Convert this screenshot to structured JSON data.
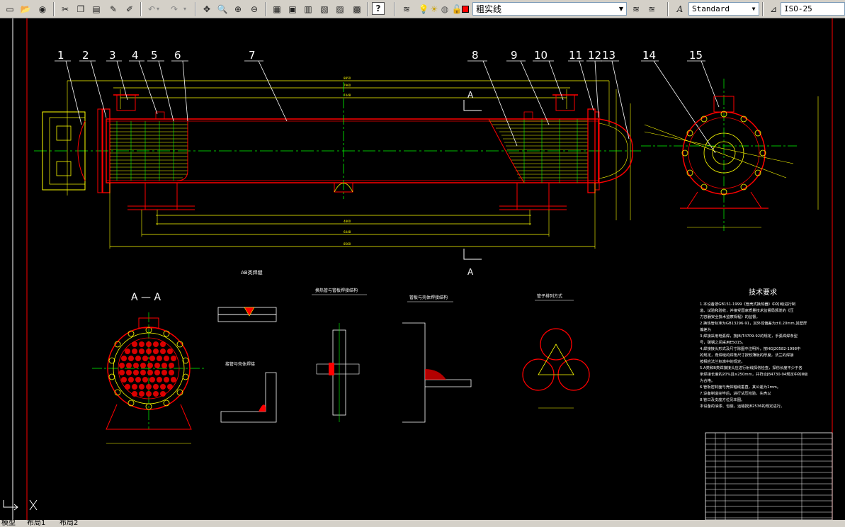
{
  "toolbar": {
    "layer_name": "粗实线",
    "text_style": "Standard",
    "dim_style": "ISO-25"
  },
  "drawing": {
    "balloons": [
      "1",
      "2",
      "3",
      "4",
      "5",
      "6",
      "7",
      "8",
      "9",
      "10",
      "11",
      "12",
      "13",
      "14",
      "15"
    ],
    "section_label_A": "A",
    "section_view_title": "A — A",
    "detail_titles": {
      "ab_weld": "AB类焊缝",
      "tube_plate": "换热管与管板焊接结构",
      "shell_nozzle": "管板与壳体焊接结构",
      "saddle_weld": "接管与壳体焊接",
      "tube_layout": "管子排列方式"
    },
    "tech_req_title": "技术要求",
    "tech_req_lines": [
      "1.本设备按GB151-1999《管壳式换热器》中的Ⅰ级进行制",
      "造、试验和验收，并接受国家质量技术监督局颁发的《压",
      "力容器安全技术监察规程》的监督。",
      "2.换热管标准为GB13296-91，其外径偏差为±0.20mm,其壁厚",
      "偏差为",
      "3.焊接采用电弧焊，按JB/T4709-92的规定，手弧焊焊条型",
      "号，碳钢之间采用E5015。",
      "4.焊接接头形式及尺寸除图中注明外，按HGJ20582-1998中",
      "的规定，角焊缝的焊角尺寸按较薄板的厚度，法兰的焊接",
      "按相应法兰标准中的规定。",
      "5.A类和B类焊接接头应进行射线探伤检查，探伤长度不少于各",
      "条焊接长度的20%且≥250mm，并符合JB4730-94规定中的Ⅲ级",
      "为合格。",
      "6.管板密封面与壳体轴线垂直，其公差为1mm。",
      "7.设备制造完毕后，进行试压检验，先壳以",
      "8.管口及支座方位见本图。",
      "本设备的油漆、包装，运输按JB2536的规定进行。"
    ]
  },
  "layout_tabs": [
    "模型",
    "布局1",
    "布局2"
  ],
  "colors": {
    "cad_bg": "#000000",
    "red": "#ff0000",
    "yellow": "#ffff00",
    "green": "#00ff00",
    "white": "#ffffff",
    "magenta": "#ff00ff"
  }
}
